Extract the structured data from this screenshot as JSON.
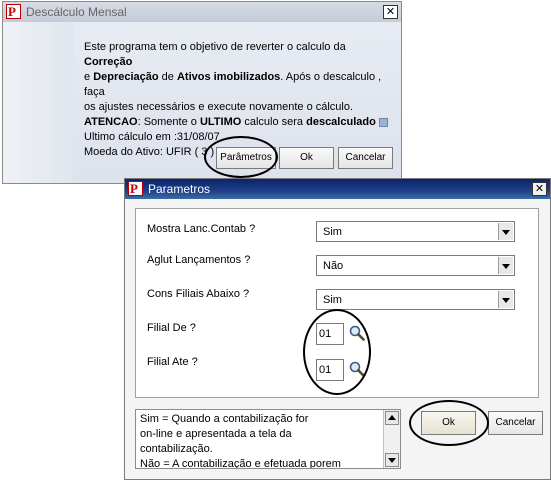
{
  "descalculo_window": {
    "title": "Descálculo Mensal",
    "close": "✕",
    "message": {
      "line1a": "Este programa tem o objetivo de reverter o calculo da ",
      "line1b": "Correção",
      "line2a": "e ",
      "line2b": "Depreciação",
      "line2c": " de ",
      "line2d": "Ativos imobilizados",
      "line2e": ". Após o descalculo , faça",
      "line3": "os ajustes  necessários e execute novamente o cálculo.",
      "line4a": "ATENCAO",
      "line4b": ": Somente o ",
      "line4c": "ULTIMO",
      "line4d": " calculo sera ",
      "line4e": "descalculado",
      "line5": "Ultimo cálculo em :31/08/07",
      "line6": "Moeda do Ativo: UFIR ( 3 )"
    },
    "buttons": {
      "parametros": "Parâmetros",
      "ok": "Ok",
      "cancelar": "Cancelar"
    }
  },
  "parametros_window": {
    "title": "Parametros",
    "close": "✕",
    "fields": [
      {
        "label": "Mostra Lanc.Contab ?",
        "value": "Sim"
      },
      {
        "label": "Aglut Lançamentos ?",
        "value": "Não"
      },
      {
        "label": "Cons Filiais Abaixo ?",
        "value": "Sim"
      }
    ],
    "filial_de": {
      "label": "Filial De ?",
      "value": "01"
    },
    "filial_ate": {
      "label": "Filial Ate ?",
      "value": "01"
    },
    "help_text": {
      "line1": "Sim = Quando a contabilização for",
      "line2": "on-line e apresentada a tela da",
      "line3": "contabilização.",
      "line4": "Não = A contabilização e efetuada porem"
    },
    "buttons": {
      "ok": "Ok",
      "cancelar": "Cancelar"
    }
  },
  "icons": [
    "app-logo-icon",
    "close-icon",
    "dropdown-arrow-icon",
    "search-icon",
    "scroll-up-icon",
    "scroll-down-icon"
  ],
  "colors": {
    "title_active": "#0a246a",
    "logo_red": "#c00000"
  }
}
